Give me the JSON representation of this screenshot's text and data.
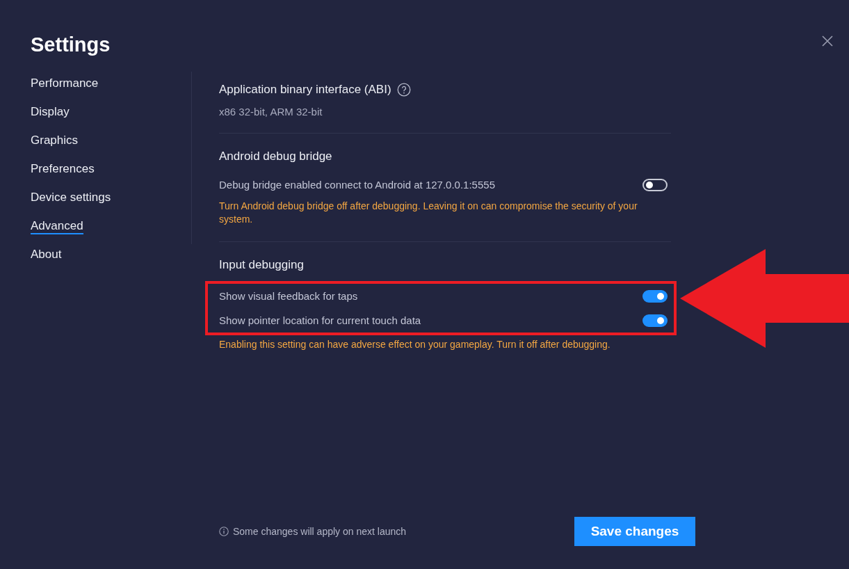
{
  "window": {
    "title": "Settings"
  },
  "sidebar": {
    "items": [
      {
        "label": "Performance",
        "selected": false
      },
      {
        "label": "Display",
        "selected": false
      },
      {
        "label": "Graphics",
        "selected": false
      },
      {
        "label": "Preferences",
        "selected": false
      },
      {
        "label": "Device settings",
        "selected": false
      },
      {
        "label": "Advanced",
        "selected": true
      },
      {
        "label": "About",
        "selected": false
      }
    ]
  },
  "sections": [
    {
      "title": "Application binary interface (ABI)",
      "help": true,
      "annotated": false,
      "rows": [
        {
          "kind": "text",
          "text": "x86 32-bit, ARM 32-bit"
        }
      ]
    },
    {
      "title": "Android debug bridge",
      "help": false,
      "annotated": false,
      "rows": [
        {
          "kind": "toggle",
          "label": "Debug bridge enabled connect to Android at 127.0.0.1:5555",
          "on": false
        },
        {
          "kind": "warning",
          "text": "Turn Android debug bridge off after debugging. Leaving it on can compromise the security of your system."
        }
      ]
    },
    {
      "title": "Input debugging",
      "help": false,
      "annotated": true,
      "rows": [
        {
          "kind": "toggle",
          "label": "Show visual feedback for taps",
          "on": true
        },
        {
          "kind": "toggle",
          "label": "Show pointer location for current touch data",
          "on": true
        },
        {
          "kind": "warning",
          "text": "Enabling this setting can have adverse effect on your gameplay. Turn it off after  debugging."
        }
      ]
    }
  ],
  "footer": {
    "note": "Some changes will apply on next launch",
    "save_button": "Save changes"
  }
}
